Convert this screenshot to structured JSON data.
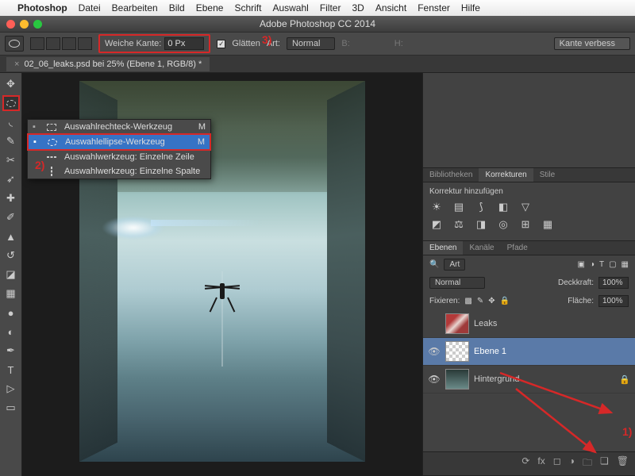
{
  "mac_menu": {
    "app": "Photoshop",
    "items": [
      "Datei",
      "Bearbeiten",
      "Bild",
      "Ebene",
      "Schrift",
      "Auswahl",
      "Filter",
      "3D",
      "Ansicht",
      "Fenster",
      "Hilfe"
    ]
  },
  "window": {
    "title": "Adobe Photoshop CC 2014"
  },
  "options": {
    "feather_label": "Weiche Kante:",
    "feather_value": "0 Px",
    "antialias": "Glätten",
    "style_label": "Art:",
    "style_value": "Normal",
    "width_label": "B:",
    "height_label": "H:",
    "refine": "Kante verbess"
  },
  "document": {
    "tab": "02_06_leaks.psd bei 25% (Ebene 1, RGB/8) *"
  },
  "flyout": {
    "items": [
      {
        "label": "Auswahlrechteck-Werkzeug",
        "key": "M",
        "selected": false,
        "icon": "rect"
      },
      {
        "label": "Auswahlellipse-Werkzeug",
        "key": "M",
        "selected": true,
        "icon": "ellipse"
      },
      {
        "label": "Auswahlwerkzeug: Einzelne Zeile",
        "key": "",
        "selected": false,
        "icon": "row"
      },
      {
        "label": "Auswahlwerkzeug: Einzelne Spalte",
        "key": "",
        "selected": false,
        "icon": "col"
      }
    ]
  },
  "panels": {
    "libs_tabs": [
      "Bibliotheken",
      "Korrekturen",
      "Stile"
    ],
    "libs_active": 1,
    "adjustments_title": "Korrektur hinzufügen",
    "layers_tabs": [
      "Ebenen",
      "Kanäle",
      "Pfade"
    ],
    "layers_active": 0,
    "filter_label": "Art",
    "blend_mode": "Normal",
    "opacity_label": "Deckkraft:",
    "opacity_value": "100%",
    "lock_label": "Fixieren:",
    "fill_label": "Fläche:",
    "fill_value": "100%",
    "layers": [
      {
        "name": "Leaks",
        "visible": false,
        "thumb": "leaks",
        "selected": false,
        "locked": false
      },
      {
        "name": "Ebene 1",
        "visible": true,
        "thumb": "checker",
        "selected": true,
        "locked": false
      },
      {
        "name": "Hintergrund",
        "visible": true,
        "thumb": "bg",
        "selected": false,
        "locked": true
      }
    ]
  },
  "annotations": {
    "a1": "1)",
    "a2": "2)",
    "a3": "3)"
  }
}
